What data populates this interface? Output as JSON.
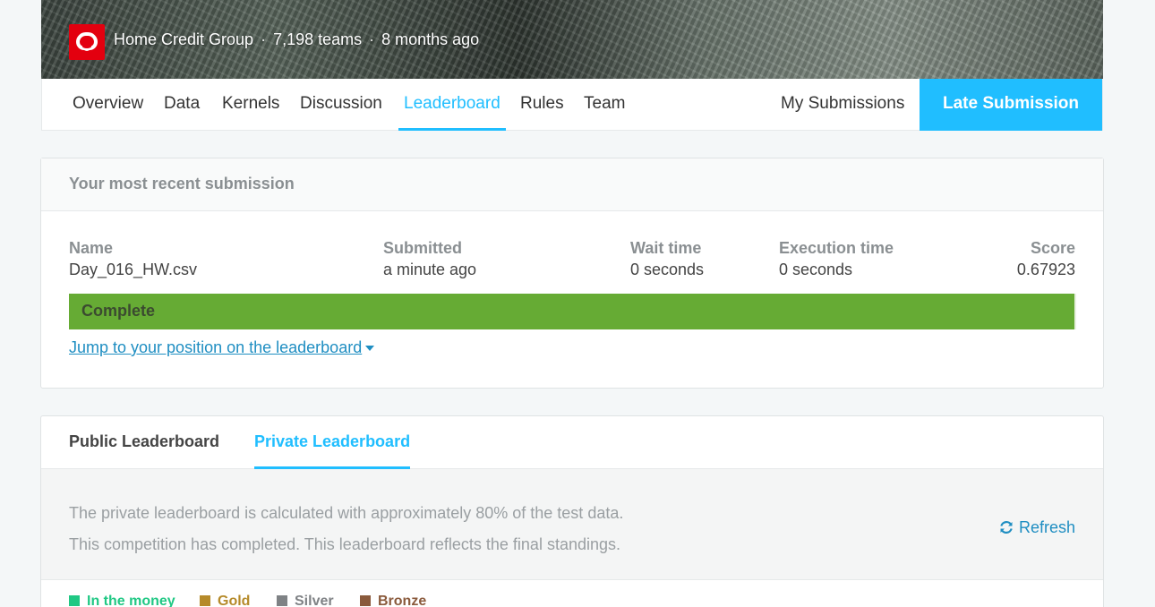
{
  "header": {
    "organization": "Home Credit Group",
    "teams": "7,198 teams",
    "separator": "·",
    "age": "8 months ago",
    "logo_icon": "home-credit-logo-icon"
  },
  "nav": {
    "tabs": [
      {
        "label": "Overview"
      },
      {
        "label": "Data"
      },
      {
        "label": "Kernels"
      },
      {
        "label": "Discussion"
      },
      {
        "label": "Leaderboard",
        "active": true
      },
      {
        "label": "Rules"
      },
      {
        "label": "Team"
      }
    ],
    "my_submissions": "My Submissions",
    "late_submission": "Late Submission"
  },
  "submission": {
    "heading": "Your most recent submission",
    "columns": {
      "name": {
        "label": "Name",
        "value": "Day_016_HW.csv"
      },
      "submitted": {
        "label": "Submitted",
        "value": "a minute ago"
      },
      "wait": {
        "label": "Wait time",
        "value": "0 seconds"
      },
      "execution": {
        "label": "Execution time",
        "value": "0 seconds"
      },
      "score": {
        "label": "Score",
        "value": "0.67923"
      }
    },
    "status": "Complete",
    "progress": 1.0,
    "jump_link": "Jump to your position on the leaderboard"
  },
  "leaderboard": {
    "tabs": [
      {
        "label": "Public Leaderboard"
      },
      {
        "label": "Private Leaderboard",
        "active": true
      }
    ],
    "info_line_1": "The private leaderboard is calculated with approximately 80% of the test data.",
    "info_line_2": "This competition has completed. This leaderboard reflects the final standings.",
    "refresh": "Refresh",
    "legend": [
      {
        "label": "In the money",
        "color": "#20c884"
      },
      {
        "label": "Gold",
        "color": "#b58a2a"
      },
      {
        "label": "Silver",
        "color": "#7f8285"
      },
      {
        "label": "Bronze",
        "color": "#8a5a3c"
      }
    ]
  },
  "colors": {
    "accent": "#20beff",
    "complete": "#66ab34",
    "link": "#1f8ec2"
  }
}
